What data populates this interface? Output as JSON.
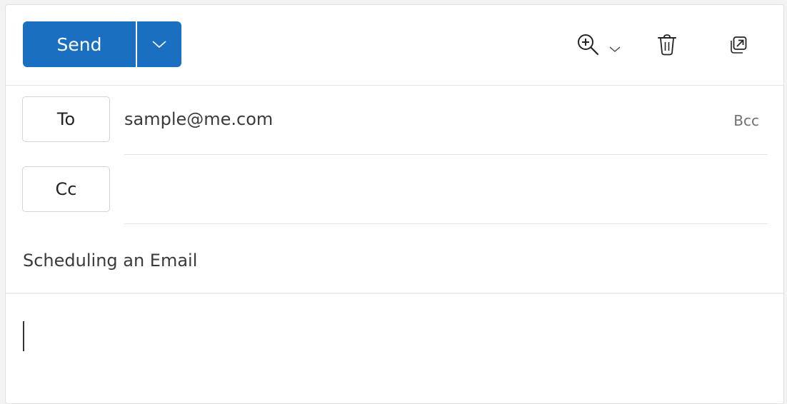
{
  "toolbar": {
    "send_label": "Send",
    "send_options_icon": "chevron-down-icon",
    "zoom_icon": "zoom-in-icon",
    "zoom_dropdown_icon": "chevron-down-icon",
    "delete_icon": "trash-icon",
    "popout_icon": "open-in-new-window-icon"
  },
  "recipients": {
    "to_label": "To",
    "to_value": "sample@me.com",
    "cc_label": "Cc",
    "cc_value": "",
    "bcc_label": "Bcc"
  },
  "subject": {
    "value": "Scheduling an Email"
  },
  "body": {
    "value": ""
  },
  "colors": {
    "accent": "#1a6fc0"
  }
}
